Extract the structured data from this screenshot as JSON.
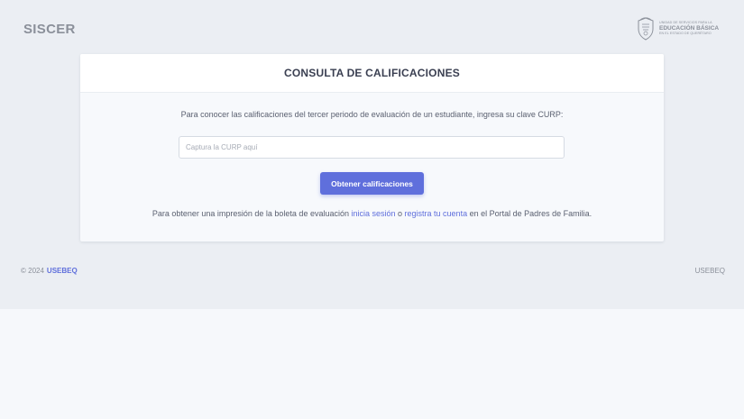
{
  "header": {
    "brand": "SISCER",
    "logo": {
      "icon": "state-seal-icon",
      "line1": "UNIDAD DE SERVICIOS PARA LA",
      "line2": "EDUCACIÓN BÁSICA",
      "line3": "EN EL ESTADO DE QUERÉTARO"
    }
  },
  "card": {
    "title": "CONSULTA DE CALIFICACIONES",
    "instructions": "Para conocer las calificaciones del tercer periodo de evaluación de un estudiante, ingresa su clave CURP:",
    "curp_input": {
      "value": "",
      "placeholder": "Captura la CURP aquí"
    },
    "submit_label": "Obtener calificaciones",
    "print_note": {
      "prefix": "Para obtener una impresión de la boleta de evaluación ",
      "login_link": "inicia sesión",
      "middle": " o ",
      "register_link": "registra tu cuenta",
      "suffix": " en el Portal de Padres de Familia."
    }
  },
  "footer": {
    "copyright": "© 2024",
    "brand_link": "USEBEQ",
    "right_text": "USEBEQ"
  },
  "colors": {
    "accent": "#5f6fdc",
    "page_background": "#ebeef3",
    "card_background": "#f7f9fc"
  }
}
